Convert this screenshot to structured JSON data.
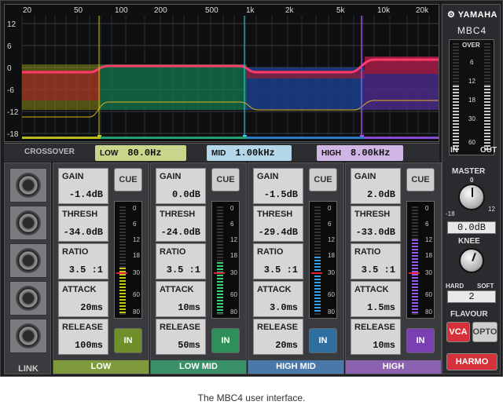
{
  "graph": {
    "freq_labels": [
      "20",
      "50",
      "100",
      "200",
      "500",
      "1k",
      "2k",
      "5k",
      "10k",
      "20k"
    ],
    "db_labels": [
      "12",
      "6",
      "0",
      "-6",
      "-12",
      "-18"
    ]
  },
  "crossover": {
    "title": "CROSSOVER",
    "low": {
      "name": "LOW",
      "value": "80.0Hz"
    },
    "mid": {
      "name": "MID",
      "value": "1.00kHz"
    },
    "high": {
      "name": "HIGH",
      "value": "8.00kHz"
    }
  },
  "link_label": "LINK",
  "param_names": {
    "gain": "GAIN",
    "thresh": "THRESH",
    "ratio": "RATIO",
    "attack": "ATTACK",
    "release": "RELEASE"
  },
  "meter_scale": [
    "0",
    "6",
    "12",
    "18",
    "30",
    "60",
    "80"
  ],
  "bands": [
    {
      "label": "LOW",
      "gain": "-1.4dB",
      "thresh": "-34.0dB",
      "ratio": "3.5 :1",
      "attack": "20ms",
      "release": "100ms",
      "cue": "CUE",
      "in": "IN",
      "color": "#6f8f2a",
      "meter_color": "#c8c818",
      "label_color": "#7f9a3c"
    },
    {
      "label": "LOW MID",
      "gain": "0.0dB",
      "thresh": "-24.0dB",
      "ratio": "3.5 :1",
      "attack": "10ms",
      "release": "50ms",
      "cue": "CUE",
      "in": "IN",
      "color": "#2f8f5a",
      "meter_color": "#3bd27a",
      "label_color": "#3a9068"
    },
    {
      "label": "HIGH MID",
      "gain": "-1.5dB",
      "thresh": "-29.4dB",
      "ratio": "3.5 :1",
      "attack": "3.0ms",
      "release": "20ms",
      "cue": "CUE",
      "in": "IN",
      "color": "#2f6fa0",
      "meter_color": "#3aa0e8",
      "label_color": "#4a78a8"
    },
    {
      "label": "HIGH",
      "gain": "2.0dB",
      "thresh": "-33.0dB",
      "ratio": "3.5 :1",
      "attack": "1.5ms",
      "release": "10ms",
      "cue": "CUE",
      "in": "IN",
      "color": "#7a3fb0",
      "meter_color": "#9a5ae8",
      "label_color": "#8a62b0"
    }
  ],
  "right": {
    "logo": "YAMAHA",
    "model": "MBC4",
    "meter_scale": [
      "OVER",
      "6",
      "12",
      "18",
      "30",
      "60"
    ],
    "meter_in": "IN",
    "meter_out": "OUT",
    "master_label": "MASTER",
    "master_value": "0.0dB",
    "master_min": "-18",
    "master_max": "12",
    "master_zero": "0",
    "knee_label": "KNEE",
    "knee_hard": "HARD",
    "knee_soft": "SOFT",
    "knee_value": "2",
    "flavour_label": "FLAVOUR",
    "vca": "VCA",
    "opto": "OPTO",
    "harmo": "HARMO"
  },
  "caption": "The MBC4 user interface."
}
